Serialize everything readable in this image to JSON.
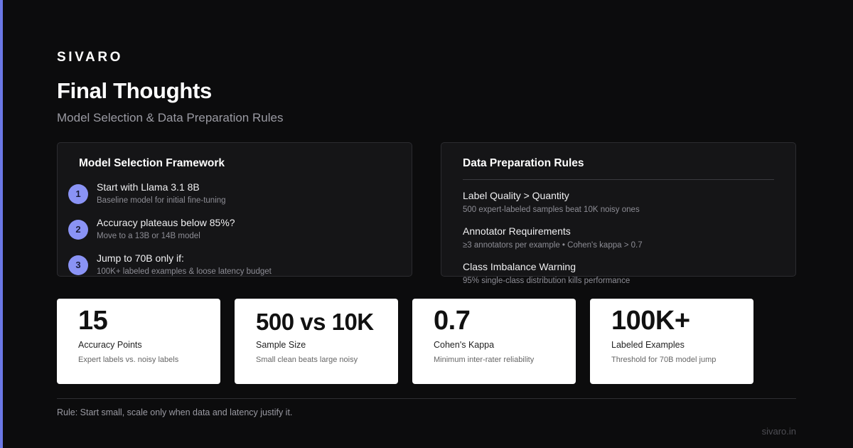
{
  "brand": "SIVARO",
  "title": "Final Thoughts",
  "subtitle": "Model Selection & Data Preparation Rules",
  "model_selection": {
    "heading": "Model Selection Framework",
    "steps": [
      {
        "num": "1",
        "title": "Start with Llama 3.1 8B",
        "desc": "Baseline model for initial fine-tuning"
      },
      {
        "num": "2",
        "title": "Accuracy plateaus below 85%?",
        "desc": "Move to a 13B or 14B model"
      },
      {
        "num": "3",
        "title": "Jump to 70B only if:",
        "desc": "100K+ labeled examples & loose latency budget"
      }
    ]
  },
  "data_prep": {
    "heading": "Data Preparation Rules",
    "rules": [
      {
        "title": "Label Quality > Quantity",
        "desc": "500 expert-labeled samples beat 10K noisy ones"
      },
      {
        "title": "Annotator Requirements",
        "desc": "≥3 annotators per example • Cohen's kappa > 0.7"
      },
      {
        "title": "Class Imbalance Warning",
        "desc": "95% single-class distribution kills performance"
      }
    ]
  },
  "stats": [
    {
      "value": "15",
      "label": "Accuracy Points",
      "desc": "Expert labels vs. noisy labels"
    },
    {
      "value": "500 vs 10K",
      "label": "Sample Size",
      "desc": "Small clean beats large noisy"
    },
    {
      "value": "0.7",
      "label": "Cohen's Kappa",
      "desc": "Minimum inter-rater reliability"
    },
    {
      "value": "100K+",
      "label": "Labeled Examples",
      "desc": "Threshold for 70B model jump"
    }
  ],
  "footer": {
    "rule": "Rule: Start small, scale only when data and latency justify it.",
    "url": "sivaro.in"
  },
  "colors": {
    "background": "#0c0c0d",
    "accent": "#6b78e6",
    "step_badge": "#8a93f5",
    "card": "#ffffff"
  }
}
